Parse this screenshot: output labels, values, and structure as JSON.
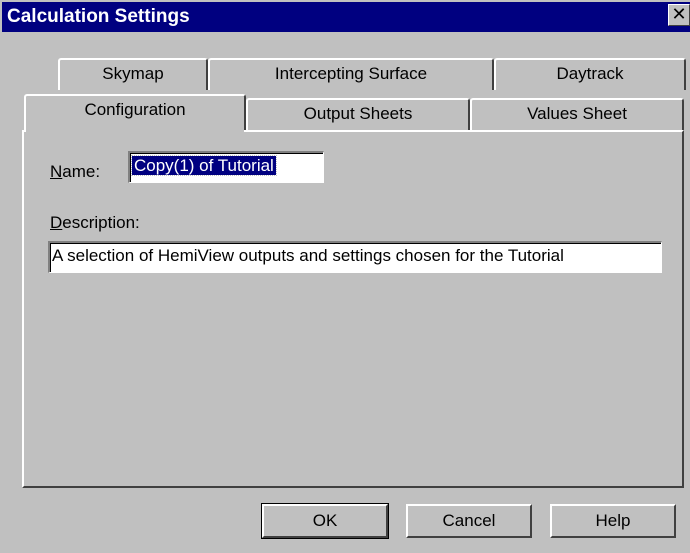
{
  "window": {
    "title": "Calculation Settings",
    "close_symbol": "✕"
  },
  "tabs": {
    "row_back": [
      {
        "label": "Skymap"
      },
      {
        "label": "Intercepting Surface"
      },
      {
        "label": "Daytrack"
      }
    ],
    "row_front": [
      {
        "label": "Configuration",
        "selected": true
      },
      {
        "label": "Output Sheets"
      },
      {
        "label": "Values Sheet"
      }
    ]
  },
  "form": {
    "name_label": "Name:",
    "name_label_mnemonic": "N",
    "name_label_rest": "ame:",
    "name_value": "Copy(1) of Tutorial",
    "description_label_mnemonic": "D",
    "description_label_rest": "escription:",
    "description_value": "A selection of HemiView outputs and settings chosen for the Tutorial"
  },
  "buttons": {
    "ok": "OK",
    "cancel": "Cancel",
    "help": "Help"
  }
}
